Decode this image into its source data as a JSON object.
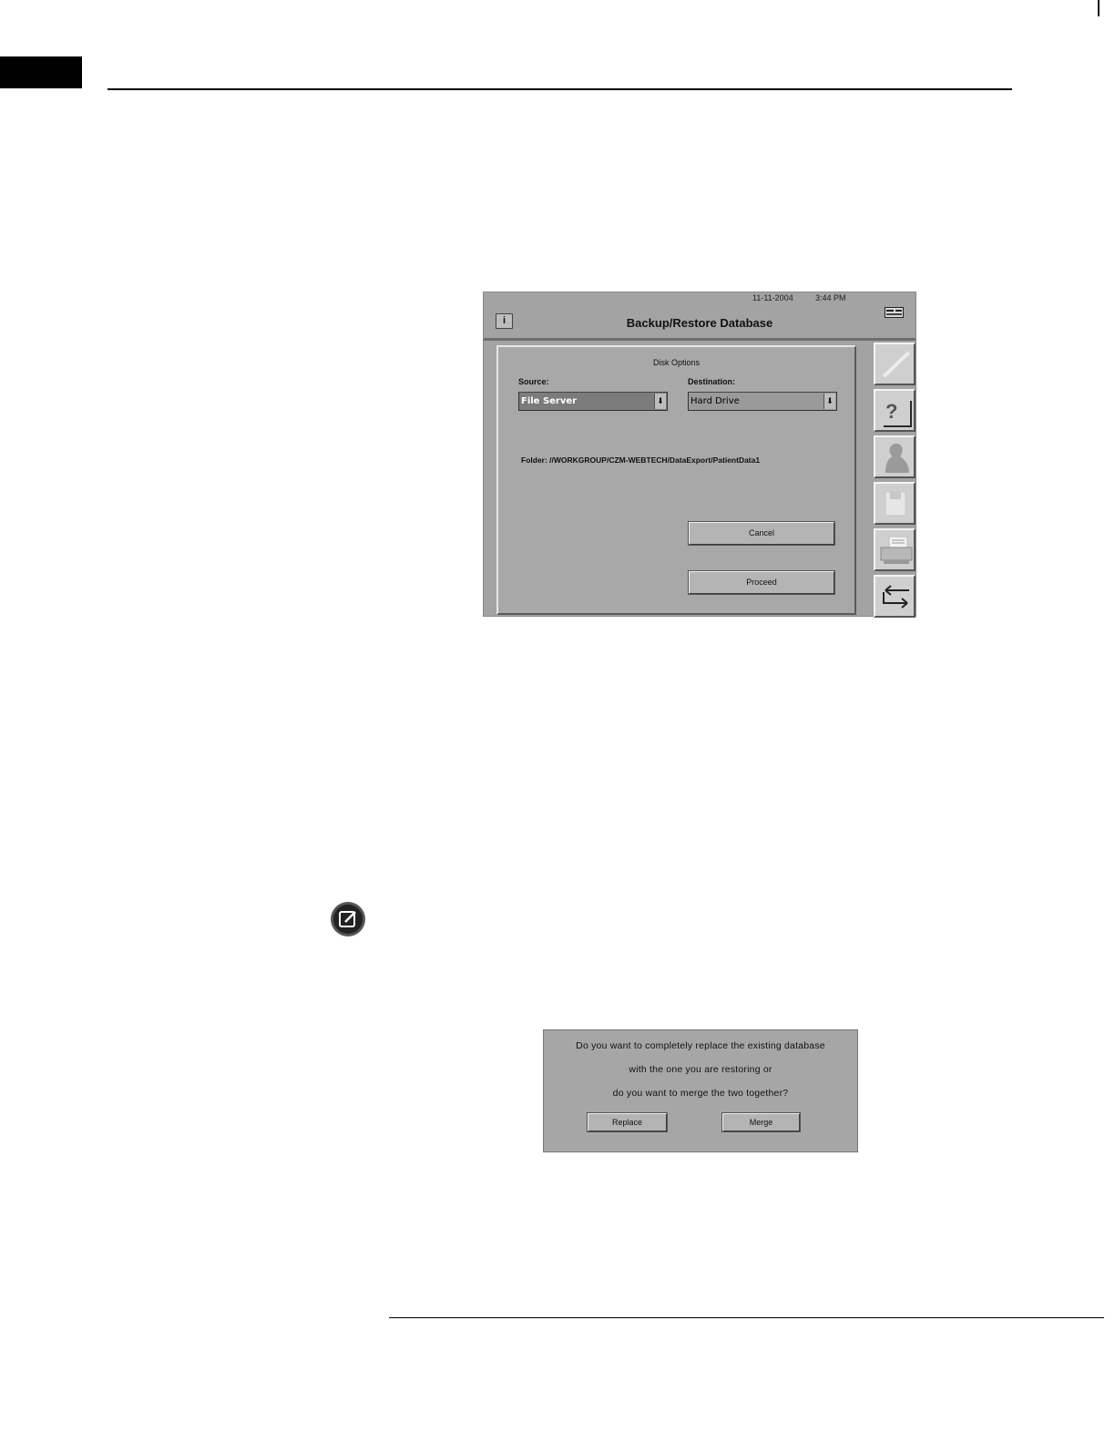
{
  "app": {
    "date": "11-11-2004",
    "time": "3:44 PM",
    "title": "Backup/Restore Database",
    "info_button": "i",
    "panel": {
      "heading": "Disk Options",
      "source_label": "Source:",
      "source_value": "File Server",
      "destination_label": "Destination:",
      "destination_value": "Hard Drive",
      "folder": "Folder: //WORKGROUP/CZM-WEBTECH/DataExport/PatientData1",
      "cancel_label": "Cancel",
      "proceed_label": "Proceed"
    },
    "side_buttons": [
      "pen-icon",
      "help-icon",
      "patient-icon",
      "disk-icon",
      "printer-icon",
      "return-icon"
    ]
  },
  "dialog": {
    "line1": "Do you want to completely replace the existing database",
    "line2": "with the one you are restoring or",
    "line3": "do you want to merge the two together?",
    "replace_label": "Replace",
    "merge_label": "Merge"
  }
}
